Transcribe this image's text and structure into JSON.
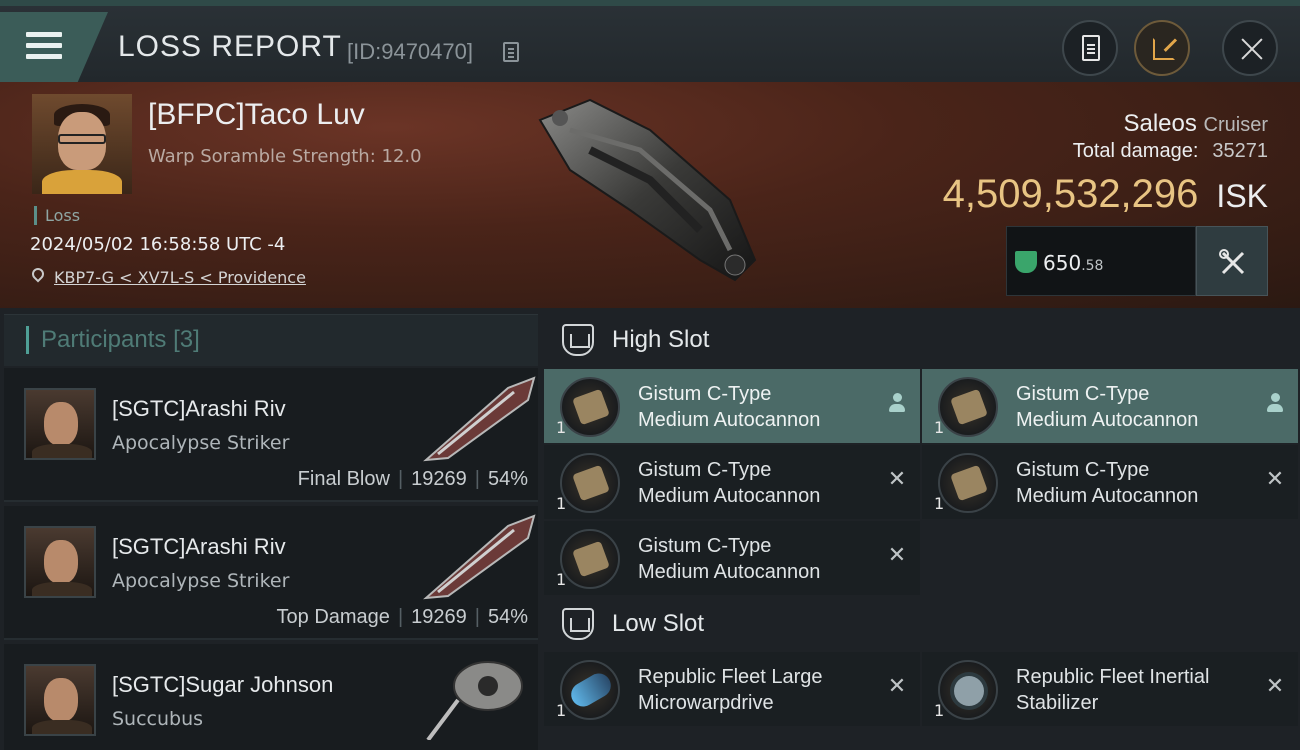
{
  "header": {
    "title": "LOSS REPORT",
    "report_id": "[ID:9470470]"
  },
  "victim": {
    "name": "[BFPC]Taco Luv",
    "warp_scramble": "Warp Soramble Strength: 12.0",
    "tag": "Loss",
    "datetime": "2024/05/02 16:58:58 UTC -4",
    "location": "KBP7-G < XV7L-S < Providence",
    "ship": "Saleos",
    "ship_class": "Cruiser",
    "total_damage_label": "Total damage:",
    "total_damage": "35271",
    "isk_value": "4,509,532,296",
    "isk_unit": "ISK",
    "stat_value": "650",
    "stat_decimal": ".58"
  },
  "participants": {
    "label": "Participants",
    "count": "[3]",
    "items": [
      {
        "name": "[SGTC]Arashi Riv",
        "ship": "Apocalypse Striker",
        "role": "Final Blow",
        "damage": "19269",
        "percent": "54%"
      },
      {
        "name": "[SGTC]Arashi Riv",
        "ship": "Apocalypse Striker",
        "role": "Top Damage",
        "damage": "19269",
        "percent": "54%"
      },
      {
        "name": "[SGTC]Sugar Johnson",
        "ship": "Succubus"
      }
    ]
  },
  "fitting": {
    "high_slot": "High Slot",
    "low_slot": "Low Slot",
    "high_modules": [
      {
        "line1": "Gistum C-Type",
        "line2": "Medium Autocannon",
        "qty": "1",
        "status": "pilot-icon"
      },
      {
        "line1": "Gistum C-Type",
        "line2": "Medium Autocannon",
        "qty": "1",
        "status": "pilot-icon"
      },
      {
        "line1": "Gistum C-Type",
        "line2": "Medium Autocannon",
        "qty": "1",
        "status": "destroyed-icon"
      },
      {
        "line1": "Gistum C-Type",
        "line2": "Medium Autocannon",
        "qty": "1",
        "status": "destroyed-icon"
      },
      {
        "line1": "Gistum C-Type",
        "line2": "Medium Autocannon",
        "qty": "1",
        "status": "destroyed-icon"
      }
    ],
    "low_modules": [
      {
        "line1": "Republic Fleet Large",
        "line2": "Microwarpdrive",
        "qty": "1",
        "status": "destroyed-icon"
      },
      {
        "line1": "Republic Fleet Inertial",
        "line2": "Stabilizer",
        "qty": "1",
        "status": "destroyed-icon"
      }
    ]
  },
  "colors": {
    "accent": "#4f9f96",
    "isk": "#e8c483",
    "active_module": "#4b6a67",
    "banner": "#4a2419"
  }
}
